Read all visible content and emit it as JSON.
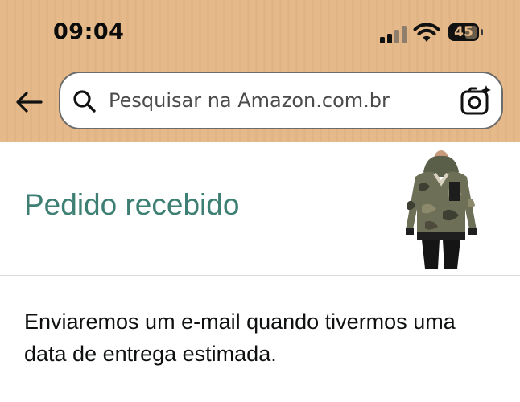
{
  "status_bar": {
    "time": "09:04",
    "battery_level": "45"
  },
  "header": {
    "background_color": "#e5b989"
  },
  "search": {
    "placeholder": "Pesquisar na Amazon.com.br",
    "value": ""
  },
  "order": {
    "title": "Pedido recebido",
    "title_color": "#3d7f73",
    "product_image": "camouflage-hooded-jacket"
  },
  "message": {
    "text": "Enviaremos um e-mail quando tivermos uma data de entrega estimada."
  },
  "icons": {
    "back": "back-arrow-icon",
    "search": "search-icon",
    "camera": "camera-search-icon",
    "signal": "cellular-signal-icon",
    "wifi": "wifi-icon",
    "battery": "battery-icon"
  }
}
